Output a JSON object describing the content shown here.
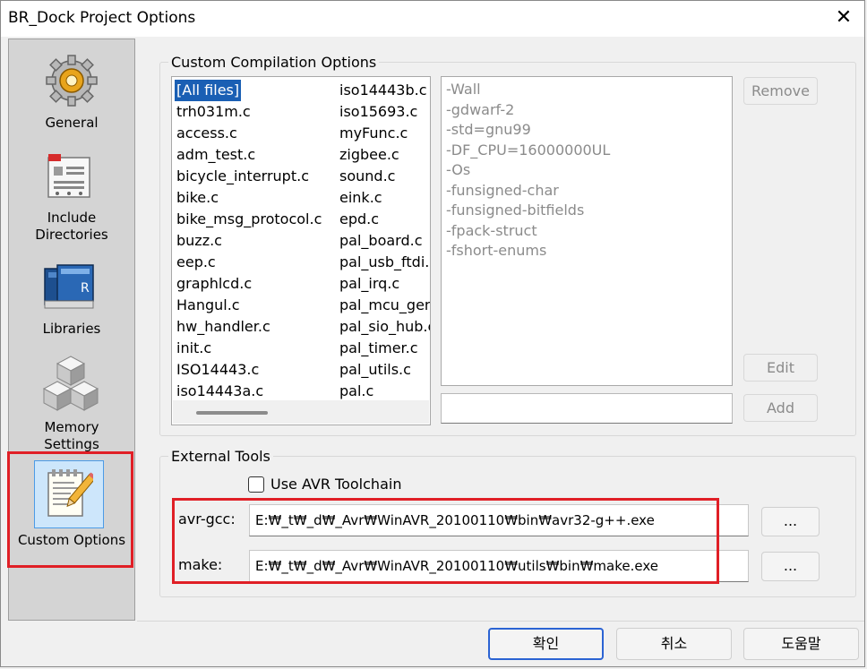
{
  "window": {
    "title": "BR_Dock Project Options",
    "close_glyph": "✕"
  },
  "sidebar": {
    "items": [
      {
        "label": "General",
        "icon": "gear-icon"
      },
      {
        "label": "Include\nDirectories",
        "icon": "include-directories-icon"
      },
      {
        "label": "Libraries",
        "icon": "books-icon"
      },
      {
        "label": "Memory\nSettings",
        "icon": "cubes-icon"
      },
      {
        "label": "Custom Options",
        "icon": "notepad-pencil-icon",
        "selected": true
      }
    ]
  },
  "compilation": {
    "group_title": "Custom Compilation Options",
    "files_col1": [
      "[All files]",
      "trh031m.c",
      "access.c",
      "adm_test.c",
      "bicycle_interrupt.c",
      "bike.c",
      "bike_msg_protocol.c",
      "buzz.c",
      "eep.c",
      "graphlcd.c",
      "Hangul.c",
      "hw_handler.c",
      "init.c",
      "ISO14443.c",
      "iso14443a.c"
    ],
    "files_col2": [
      "iso14443b.c",
      "iso15693.c",
      "myFunc.c",
      "zigbee.c",
      "sound.c",
      "eink.c",
      "epd.c",
      "pal_board.c",
      "pal_usb_ftdi.c",
      "pal_irq.c",
      "pal_mcu_generic.c",
      "pal_sio_hub.c",
      "pal_timer.c",
      "pal_utils.c",
      "pal.c"
    ],
    "selected_file": "[All files]",
    "options": [
      "-Wall",
      "-gdwarf-2",
      "-std=gnu99",
      "-DF_CPU=16000000UL",
      "-Os",
      "-funsigned-char",
      "-funsigned-bitfields",
      "-fpack-struct",
      "-fshort-enums"
    ],
    "option_input_value": "",
    "remove_label": "Remove",
    "edit_label": "Edit",
    "add_label": "Add"
  },
  "external": {
    "group_title": "External Tools",
    "use_avr_label": "Use AVR Toolchain",
    "use_avr_checked": false,
    "avr_gcc_label": "avr-gcc:",
    "avr_gcc_path": "E:₩_t₩_d₩_Avr₩WinAVR_20100110₩bin₩avr32-g++.exe",
    "make_label": "make:",
    "make_path": "E:₩_t₩_d₩_Avr₩WinAVR_20100110₩utils₩bin₩make.exe",
    "browse_label": "..."
  },
  "footer": {
    "ok_label": "확인",
    "cancel_label": "취소",
    "help_label": "도움말"
  },
  "colors": {
    "highlight": "#e01f26",
    "selection": "#1a5fb4",
    "primary_border": "#2b63d3"
  }
}
